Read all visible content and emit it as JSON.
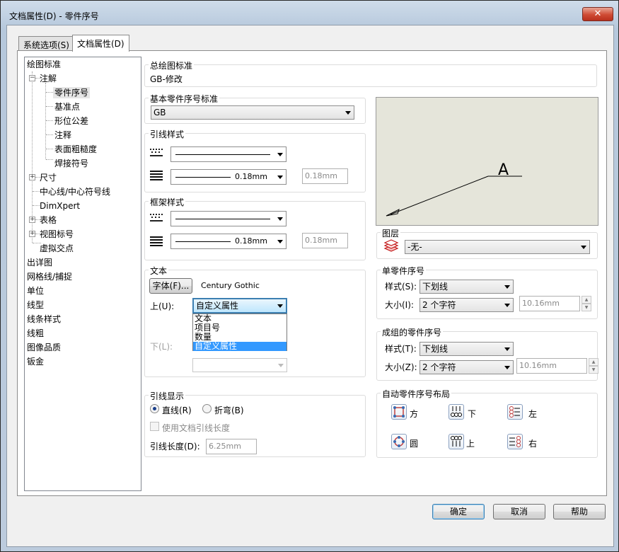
{
  "window": {
    "title": "文档属性(D) - 零件序号",
    "close_label": "✕"
  },
  "tabs": [
    {
      "label": "系统选项(S)"
    },
    {
      "label": "文档属性(D)"
    }
  ],
  "tree": {
    "items": [
      "绘图标准",
      "注解",
      "零件序号",
      "基准点",
      "形位公差",
      "注释",
      "表面粗糙度",
      "焊接符号",
      "尺寸",
      "中心线/中心符号线",
      "DimXpert",
      "表格",
      "视图标号",
      "虚拟交点",
      "出详图",
      "网格线/捕捉",
      "单位",
      "线型",
      "线条样式",
      "线粗",
      "图像品质",
      "钣金"
    ]
  },
  "overall_standard": {
    "label": "总绘图标准",
    "value": "GB-修改"
  },
  "base_standard": {
    "label": "基本零件序号标准",
    "value": "GB"
  },
  "leader_style": {
    "label": "引线样式",
    "thickness": "0.18mm",
    "custom_thickness": "0.18mm"
  },
  "frame_style": {
    "label": "框架样式",
    "thickness": "0.18mm",
    "custom_thickness": "0.18mm"
  },
  "text": {
    "label": "文本",
    "font_button": "字体(F)...",
    "font_name": "Century Gothic",
    "upper_label": "上(U):",
    "upper_value": "自定义属性",
    "lower_label": "下(L):",
    "dropdown_options": [
      "文本",
      "项目号",
      "数量",
      "自定义属性"
    ],
    "dropdown_selected": "自定义属性"
  },
  "leader_display": {
    "label": "引线显示",
    "straight": "直线(R)",
    "bent": "折弯(B)",
    "use_doc_length": "使用文档引线长度",
    "length_label": "引线长度(D):",
    "length_value": "6.25mm"
  },
  "preview": {
    "balloon_text": "A"
  },
  "layer": {
    "label": "图层",
    "value": "-无-"
  },
  "single_balloon": {
    "label": "单零件序号",
    "style_label": "样式(S):",
    "style_value": "下划线",
    "size_label": "大小(I):",
    "size_value": "2 个字符",
    "size_custom": "10.16mm"
  },
  "stacked_balloon": {
    "label": "成组的零件序号",
    "style_label": "样式(T):",
    "style_value": "下划线",
    "size_label": "大小(Z):",
    "size_value": "2 个字符",
    "size_custom": "10.16mm"
  },
  "auto_layout": {
    "label": "自动零件序号布局",
    "square": "方",
    "down": "下",
    "left": "左",
    "circle": "圆",
    "up": "上",
    "right": "右"
  },
  "buttons": {
    "ok": "确定",
    "cancel": "取消",
    "help": "帮助"
  },
  "colors": {
    "selection": "#3399ff",
    "preview_bg": "#e5e5da",
    "close_red": "#cf4a33"
  }
}
